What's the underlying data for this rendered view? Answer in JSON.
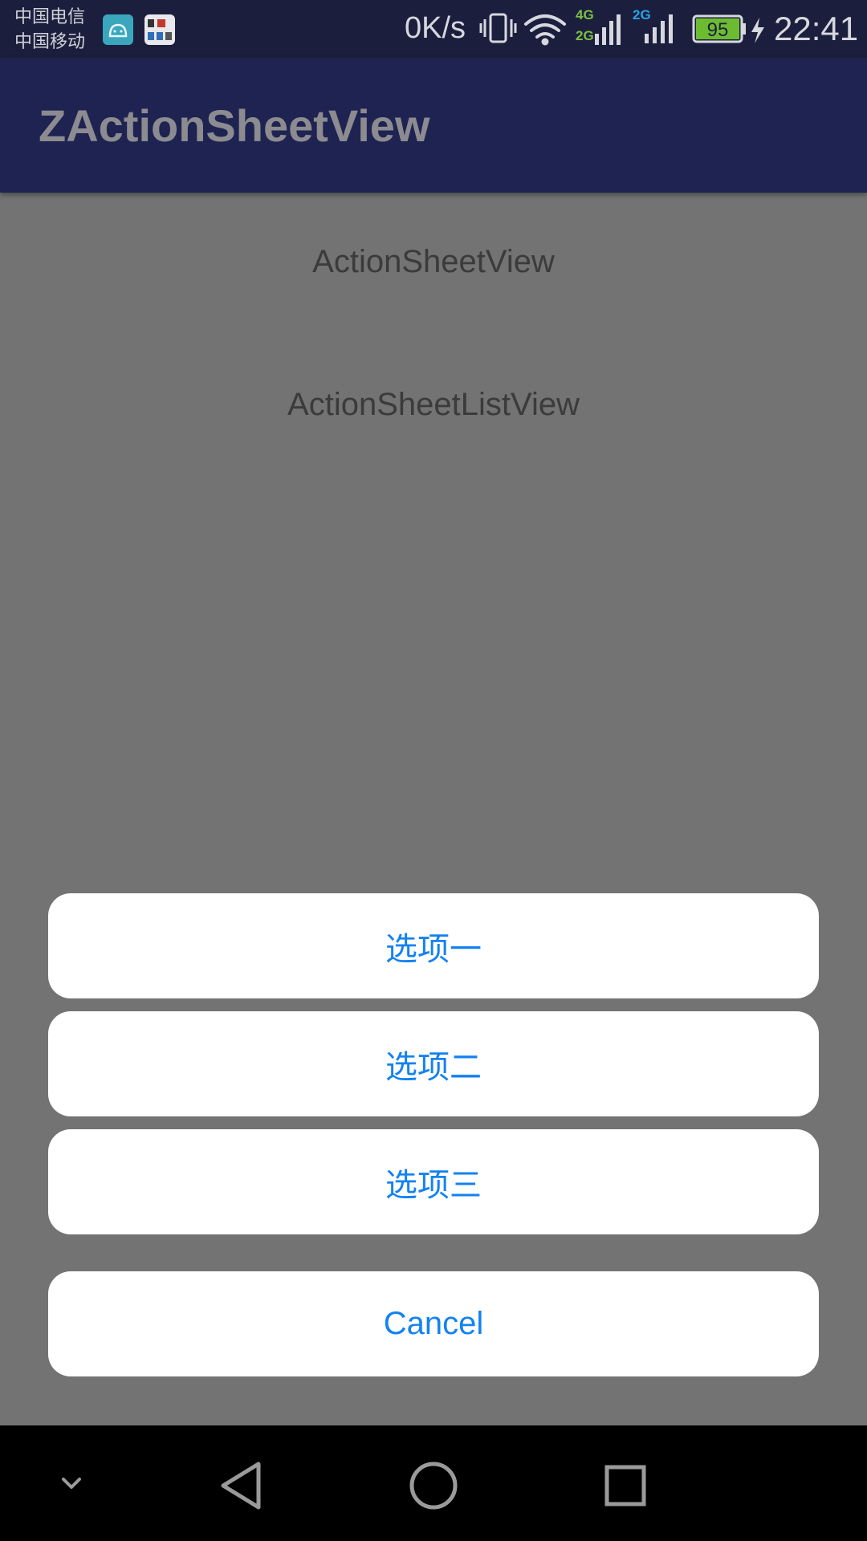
{
  "status_bar": {
    "carrier_1": "中国电信",
    "carrier_2": "中国移动",
    "net_speed": "0K/s",
    "sim1_label": "4G",
    "sim1_sub_label": "2G",
    "sim2_label": "2G",
    "battery_level": "95",
    "time": "22:41"
  },
  "app_bar": {
    "title": "ZActionSheetView"
  },
  "content": {
    "link_1": "ActionSheetView",
    "link_2": "ActionSheetListView"
  },
  "action_sheet": {
    "options": [
      "选项一",
      "选项二",
      "选项三"
    ],
    "cancel": "Cancel"
  },
  "colors": {
    "status_bar_bg": "#1b1f3d",
    "app_bar_bg": "#1e2352",
    "scrim_bg": "#737373",
    "sheet_text": "#1482f0",
    "battery_fill": "#6dbb30",
    "network_green": "#7bc043",
    "network_blue": "#26a4e6"
  },
  "nav_bar": {
    "icons": [
      "chevron-down-icon",
      "back-icon",
      "home-icon",
      "recents-icon"
    ]
  }
}
